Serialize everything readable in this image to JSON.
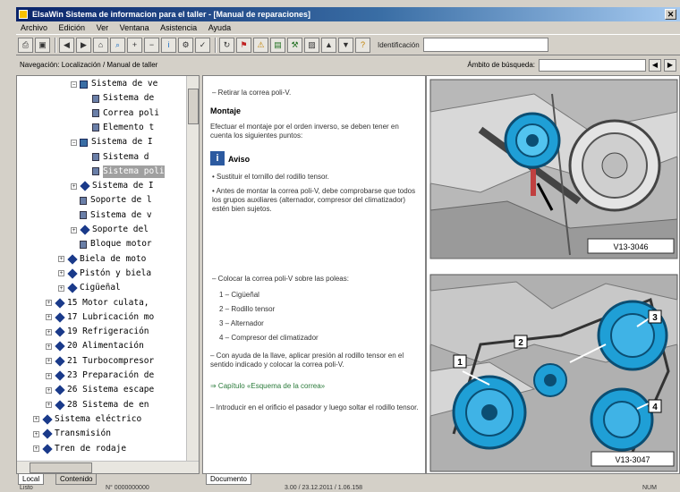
{
  "window": {
    "title": "ElsaWin Sistema de informacion para el taller - [Manual de reparaciones]",
    "close_glyph": "✕"
  },
  "menu": [
    "Archivo",
    "Edición",
    "Ver",
    "Ventana",
    "Asistencia",
    "Ayuda"
  ],
  "toolbar": {
    "buttons": [
      "print-icon",
      "save-icon",
      "back-icon",
      "forward-icon",
      "home-icon",
      "search-icon",
      "zoom-in-icon",
      "zoom-out-icon",
      "info-icon",
      "settings-icon",
      "check-icon",
      "refresh-icon",
      "flag-icon",
      "warning-icon",
      "book-icon",
      "tool-icon",
      "photo-icon",
      "arrow-up-icon",
      "arrow-down-icon",
      "help-icon"
    ],
    "field_label": "Identificación",
    "field_value": ""
  },
  "nav": {
    "left_label": "Navegación: Localización / Manual de taller",
    "right_label": "Ámbito de búsqueda:",
    "prev_glyph": "◀",
    "next_glyph": "▶"
  },
  "tree": [
    {
      "indent": 4,
      "expander": "−",
      "icon": "book",
      "label": "Sistema de ve",
      "selected": false
    },
    {
      "indent": 5,
      "expander": "",
      "icon": "doc",
      "label": "Sistema de ",
      "selected": false
    },
    {
      "indent": 5,
      "expander": "",
      "icon": "doc",
      "label": "Correa poli",
      "selected": false
    },
    {
      "indent": 5,
      "expander": "",
      "icon": "doc",
      "label": "Elemento t",
      "selected": false
    },
    {
      "indent": 4,
      "expander": "−",
      "icon": "book",
      "label": "Sistema de I",
      "selected": false
    },
    {
      "indent": 5,
      "expander": "",
      "icon": "doc",
      "label": "Sistema d",
      "selected": false
    },
    {
      "indent": 5,
      "expander": "",
      "icon": "doc",
      "label": "Sistema poli",
      "selected": true
    },
    {
      "indent": 4,
      "expander": "+",
      "icon": "folder",
      "label": "Sistema de I",
      "selected": false
    },
    {
      "indent": 4,
      "expander": "",
      "icon": "doc",
      "label": "Soporte de l",
      "selected": false
    },
    {
      "indent": 4,
      "expander": "",
      "icon": "doc",
      "label": "Sistema de v",
      "selected": false
    },
    {
      "indent": 4,
      "expander": "+",
      "icon": "folder",
      "label": "Soporte del",
      "selected": false
    },
    {
      "indent": 4,
      "expander": "",
      "icon": "doc",
      "label": "Bloque motor",
      "selected": false
    },
    {
      "indent": 3,
      "expander": "+",
      "icon": "folder",
      "label": "Biela de moto",
      "selected": false
    },
    {
      "indent": 3,
      "expander": "+",
      "icon": "folder",
      "label": "Pistón y biela",
      "selected": false
    },
    {
      "indent": 3,
      "expander": "+",
      "icon": "folder",
      "label": "Cigüeñal",
      "selected": false
    },
    {
      "indent": 2,
      "expander": "+",
      "icon": "folder",
      "label": "15 Motor culata,",
      "selected": false
    },
    {
      "indent": 2,
      "expander": "+",
      "icon": "folder",
      "label": "17 Lubricación mo",
      "selected": false
    },
    {
      "indent": 2,
      "expander": "+",
      "icon": "folder",
      "label": "19 Refrigeración",
      "selected": false
    },
    {
      "indent": 2,
      "expander": "+",
      "icon": "folder",
      "label": "20 Alimentación",
      "selected": false
    },
    {
      "indent": 2,
      "expander": "+",
      "icon": "folder",
      "label": "21 Turbocompresor",
      "selected": false
    },
    {
      "indent": 2,
      "expander": "+",
      "icon": "folder",
      "label": "23 Preparación de",
      "selected": false
    },
    {
      "indent": 2,
      "expander": "+",
      "icon": "folder",
      "label": "26 Sistema escape",
      "selected": false
    },
    {
      "indent": 2,
      "expander": "+",
      "icon": "folder",
      "label": "28 Sistema de en",
      "selected": false
    },
    {
      "indent": 1,
      "expander": "+",
      "icon": "folder",
      "label": "Sistema eléctrico",
      "selected": false
    },
    {
      "indent": 1,
      "expander": "+",
      "icon": "folder",
      "label": "Transmisión",
      "selected": false
    },
    {
      "indent": 1,
      "expander": "+",
      "icon": "folder",
      "label": "Tren de rodaje",
      "selected": false
    }
  ],
  "tabs_left": [
    "Local",
    "Contenido"
  ],
  "content": {
    "step1": "– Retirar la correa poli-V.",
    "heading": "Montaje",
    "intro": "Efectuar el montaje por el orden inverso, se deben tener en cuenta los siguientes puntos:",
    "note_mark": "i",
    "note_title": "Aviso",
    "bullets": [
      "• Sustituir el tornillo del rodillo tensor.",
      "• Antes de montar la correa poli-V, debe comprobarse que todos los grupos auxiliares (alternador, compresor del climatizador) estén bien sujetos."
    ],
    "step2": "– Colocar la correa poli-V sobre las poleas:",
    "list": [
      "1 – Cigüeñal",
      "2 – Rodillo tensor",
      "3 – Alternador",
      "4 – Compresor del climatizador"
    ],
    "step3": "– Con ayuda de la llave, aplicar presión al rodillo tensor en el sentido indicado y colocar la correa poli-V.",
    "link": "⇒ Capítulo «Esquema de la correa»",
    "step4": "– Introducir en el orificio el pasador y luego soltar el rodillo tensor."
  },
  "images": {
    "top_code": "V13-3046",
    "bottom_code": "V13-3047",
    "callouts": [
      "1",
      "2",
      "3",
      "4"
    ]
  },
  "tabs_content": [
    "Documento"
  ],
  "status": {
    "left": "Listo",
    "mid": "N° 0000000000",
    "right": "3.00 / 23.12.2011 / 1.06.158",
    "far": "NUM"
  }
}
